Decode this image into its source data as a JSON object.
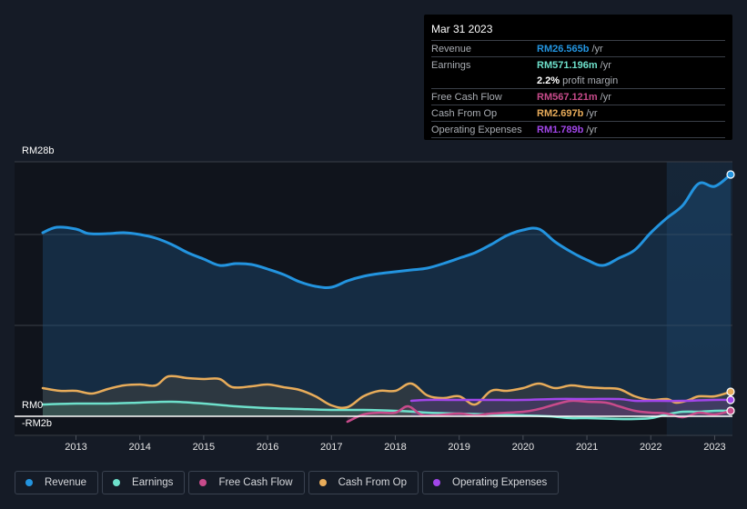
{
  "tooltip": {
    "date": "Mar 31 2023",
    "rows": [
      {
        "label": "Revenue",
        "value": "RM26.565b",
        "unit": "/yr",
        "color": "#2394df"
      },
      {
        "label": "Earnings",
        "value": "RM571.196m",
        "unit": "/yr",
        "color": "#6ee0cb"
      },
      {
        "label": "",
        "value": "2.2%",
        "unit": "profit margin",
        "color": "#ffffff"
      },
      {
        "label": "Free Cash Flow",
        "value": "RM567.121m",
        "unit": "/yr",
        "color": "#c84b8b"
      },
      {
        "label": "Cash From Op",
        "value": "RM2.697b",
        "unit": "/yr",
        "color": "#e8ac5a"
      },
      {
        "label": "Operating Expenses",
        "value": "RM1.789b",
        "unit": "/yr",
        "color": "#a146e9"
      }
    ]
  },
  "legend": [
    {
      "label": "Revenue",
      "color": "#2394df"
    },
    {
      "label": "Earnings",
      "color": "#6ee0cb"
    },
    {
      "label": "Free Cash Flow",
      "color": "#c84b8b"
    },
    {
      "label": "Cash From Op",
      "color": "#e8ac5a"
    },
    {
      "label": "Operating Expenses",
      "color": "#a146e9"
    }
  ],
  "chart_data": {
    "type": "area",
    "title": "",
    "xlabel": "",
    "ylabel": "",
    "y_tick_labels": [
      "RM28b",
      "RM0",
      "-RM2b"
    ],
    "ylim": [
      -2,
      28
    ],
    "xlim": [
      2012.48,
      2023.25
    ],
    "x_tick_labels": [
      "2013",
      "2014",
      "2015",
      "2016",
      "2017",
      "2018",
      "2019",
      "2020",
      "2021",
      "2022",
      "2023"
    ],
    "x_ticks": [
      2013,
      2014,
      2015,
      2016,
      2017,
      2018,
      2019,
      2020,
      2021,
      2022,
      2023
    ],
    "grid": true,
    "highlight_from": 2022.25,
    "units": "RM billions",
    "series": [
      {
        "name": "Revenue",
        "color": "#2394df",
        "fill": true,
        "x": [
          2012.48,
          2012.7,
          2013.0,
          2013.2,
          2013.5,
          2013.75,
          2014.0,
          2014.25,
          2014.5,
          2014.75,
          2015.0,
          2015.25,
          2015.5,
          2015.75,
          2016.0,
          2016.25,
          2016.5,
          2016.75,
          2017.0,
          2017.25,
          2017.5,
          2017.75,
          2018.0,
          2018.25,
          2018.5,
          2018.75,
          2019.0,
          2019.25,
          2019.5,
          2019.75,
          2020.0,
          2020.25,
          2020.5,
          2020.75,
          2021.0,
          2021.25,
          2021.5,
          2021.75,
          2022.0,
          2022.25,
          2022.5,
          2022.75,
          2023.0,
          2023.25
        ],
        "values": [
          20.2,
          20.8,
          20.6,
          20.1,
          20.1,
          20.2,
          20.0,
          19.6,
          18.9,
          18.0,
          17.3,
          16.6,
          16.8,
          16.7,
          16.2,
          15.6,
          14.8,
          14.3,
          14.2,
          14.9,
          15.4,
          15.7,
          15.9,
          16.1,
          16.3,
          16.8,
          17.4,
          18.0,
          18.9,
          19.9,
          20.5,
          20.6,
          19.2,
          18.1,
          17.2,
          16.6,
          17.4,
          18.3,
          20.2,
          21.8,
          23.2,
          25.6,
          25.3,
          26.6
        ]
      },
      {
        "name": "Earnings",
        "color": "#6ee0cb",
        "fill": true,
        "x": [
          2012.48,
          2013.0,
          2013.5,
          2014.0,
          2014.5,
          2015.0,
          2015.5,
          2016.0,
          2016.5,
          2017.0,
          2017.5,
          2018.0,
          2018.3,
          2018.5,
          2019.0,
          2019.5,
          2020.0,
          2020.4,
          2020.75,
          2021.0,
          2021.5,
          2021.75,
          2022.0,
          2022.25,
          2022.5,
          2022.75,
          2023.0,
          2023.25
        ],
        "values": [
          1.3,
          1.4,
          1.4,
          1.5,
          1.6,
          1.4,
          1.1,
          0.9,
          0.8,
          0.7,
          0.7,
          0.6,
          0.5,
          0.4,
          0.3,
          0.2,
          0.1,
          0.0,
          -0.2,
          -0.2,
          -0.3,
          -0.3,
          -0.2,
          0.2,
          0.5,
          0.5,
          0.6,
          0.6
        ]
      },
      {
        "name": "Free Cash Flow",
        "color": "#c84b8b",
        "fill": true,
        "x": [
          2017.25,
          2017.5,
          2017.75,
          2018.0,
          2018.2,
          2018.4,
          2018.6,
          2019.0,
          2019.25,
          2019.5,
          2020.0,
          2020.25,
          2020.5,
          2020.75,
          2021.0,
          2021.3,
          2021.5,
          2021.75,
          2022.0,
          2022.25,
          2022.5,
          2022.75,
          2023.0,
          2023.25
        ],
        "values": [
          -0.6,
          0.2,
          0.4,
          0.4,
          1.1,
          0.2,
          0.1,
          0.3,
          0.1,
          0.3,
          0.5,
          0.8,
          1.3,
          1.7,
          1.6,
          1.5,
          1.1,
          0.6,
          0.4,
          0.3,
          -0.1,
          0.4,
          0.2,
          0.6
        ]
      },
      {
        "name": "Cash From Op",
        "color": "#e8ac5a",
        "fill": true,
        "x": [
          2012.48,
          2012.75,
          2013.0,
          2013.25,
          2013.5,
          2013.75,
          2014.0,
          2014.25,
          2014.45,
          2014.75,
          2015.0,
          2015.25,
          2015.45,
          2015.75,
          2016.0,
          2016.25,
          2016.5,
          2016.75,
          2017.0,
          2017.25,
          2017.5,
          2017.75,
          2018.0,
          2018.25,
          2018.5,
          2018.75,
          2019.0,
          2019.25,
          2019.5,
          2019.75,
          2020.0,
          2020.25,
          2020.5,
          2020.75,
          2021.0,
          2021.25,
          2021.5,
          2021.75,
          2022.0,
          2022.25,
          2022.4,
          2022.6,
          2022.75,
          2023.0,
          2023.25
        ],
        "values": [
          3.1,
          2.8,
          2.8,
          2.5,
          3.0,
          3.4,
          3.5,
          3.4,
          4.4,
          4.2,
          4.1,
          4.1,
          3.2,
          3.3,
          3.5,
          3.2,
          2.9,
          2.2,
          1.2,
          1.0,
          2.2,
          2.8,
          2.8,
          3.6,
          2.3,
          2.0,
          2.2,
          1.3,
          2.8,
          2.8,
          3.1,
          3.6,
          3.1,
          3.4,
          3.2,
          3.1,
          3.0,
          2.2,
          1.8,
          1.9,
          1.5,
          1.8,
          2.2,
          2.2,
          2.7
        ]
      },
      {
        "name": "Operating Expenses",
        "color": "#a146e9",
        "fill": true,
        "x": [
          2018.25,
          2018.5,
          2019.0,
          2019.5,
          2020.0,
          2020.5,
          2021.0,
          2021.5,
          2021.75,
          2022.0,
          2022.5,
          2023.0,
          2023.25
        ],
        "values": [
          1.7,
          1.8,
          1.8,
          1.8,
          1.8,
          1.9,
          1.9,
          1.9,
          1.7,
          1.7,
          1.7,
          1.8,
          1.8
        ]
      }
    ]
  }
}
